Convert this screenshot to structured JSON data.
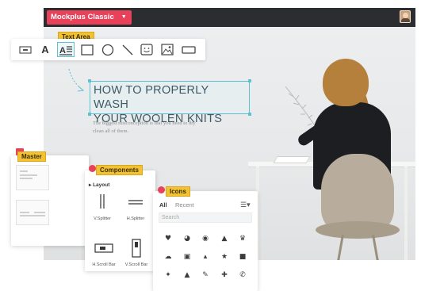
{
  "app": {
    "title": "Mockplus Classic"
  },
  "toolbar": {
    "label": "Text Area",
    "tools": [
      {
        "icon": "button-icon"
      },
      {
        "icon": "text-icon",
        "text": "A"
      },
      {
        "icon": "text-area-icon"
      },
      {
        "icon": "rectangle-icon"
      },
      {
        "icon": "circle-icon"
      },
      {
        "icon": "line-icon"
      },
      {
        "icon": "smiley-icon"
      },
      {
        "icon": "image-icon"
      },
      {
        "icon": "input-icon"
      }
    ]
  },
  "canvas": {
    "headline": [
      "HOW TO PROPERLY WASH",
      "YOUR WOOLEN KNITS"
    ],
    "subtext": [
      "The biggest misconception is that you need to dry",
      "clean all of them."
    ]
  },
  "master": {
    "label": "Master"
  },
  "components": {
    "label": "Components",
    "section": "Layout",
    "items": [
      {
        "label": "V.Splitter",
        "icon": "vertical-splitter-icon"
      },
      {
        "label": "H.Splitter",
        "icon": "horizontal-splitter-icon"
      },
      {
        "label": "H.Scroll Bar",
        "icon": "horizontal-scrollbar-icon"
      },
      {
        "label": "V.Scroll Bar",
        "icon": "vertical-scrollbar-icon"
      }
    ]
  },
  "icons": {
    "label": "Icons",
    "tabs": [
      "All",
      "Recent"
    ],
    "search_placeholder": "Search",
    "grid": [
      [
        "heart-icon",
        "pie-chart-icon",
        "eye-icon",
        "bell-icon",
        "trophy-icon"
      ],
      [
        "cloud-icon",
        "gift-icon",
        "thumbs-up-icon",
        "star-icon",
        "lock-icon"
      ],
      [
        "pin-icon",
        "flask-icon",
        "pencil-icon",
        "wrench-icon",
        "phone-icon"
      ]
    ]
  },
  "colors": {
    "brand": "#e8425a",
    "highlight": "#5fc0d3",
    "tag": "#f2c234",
    "topbar": "#2b2d31"
  }
}
